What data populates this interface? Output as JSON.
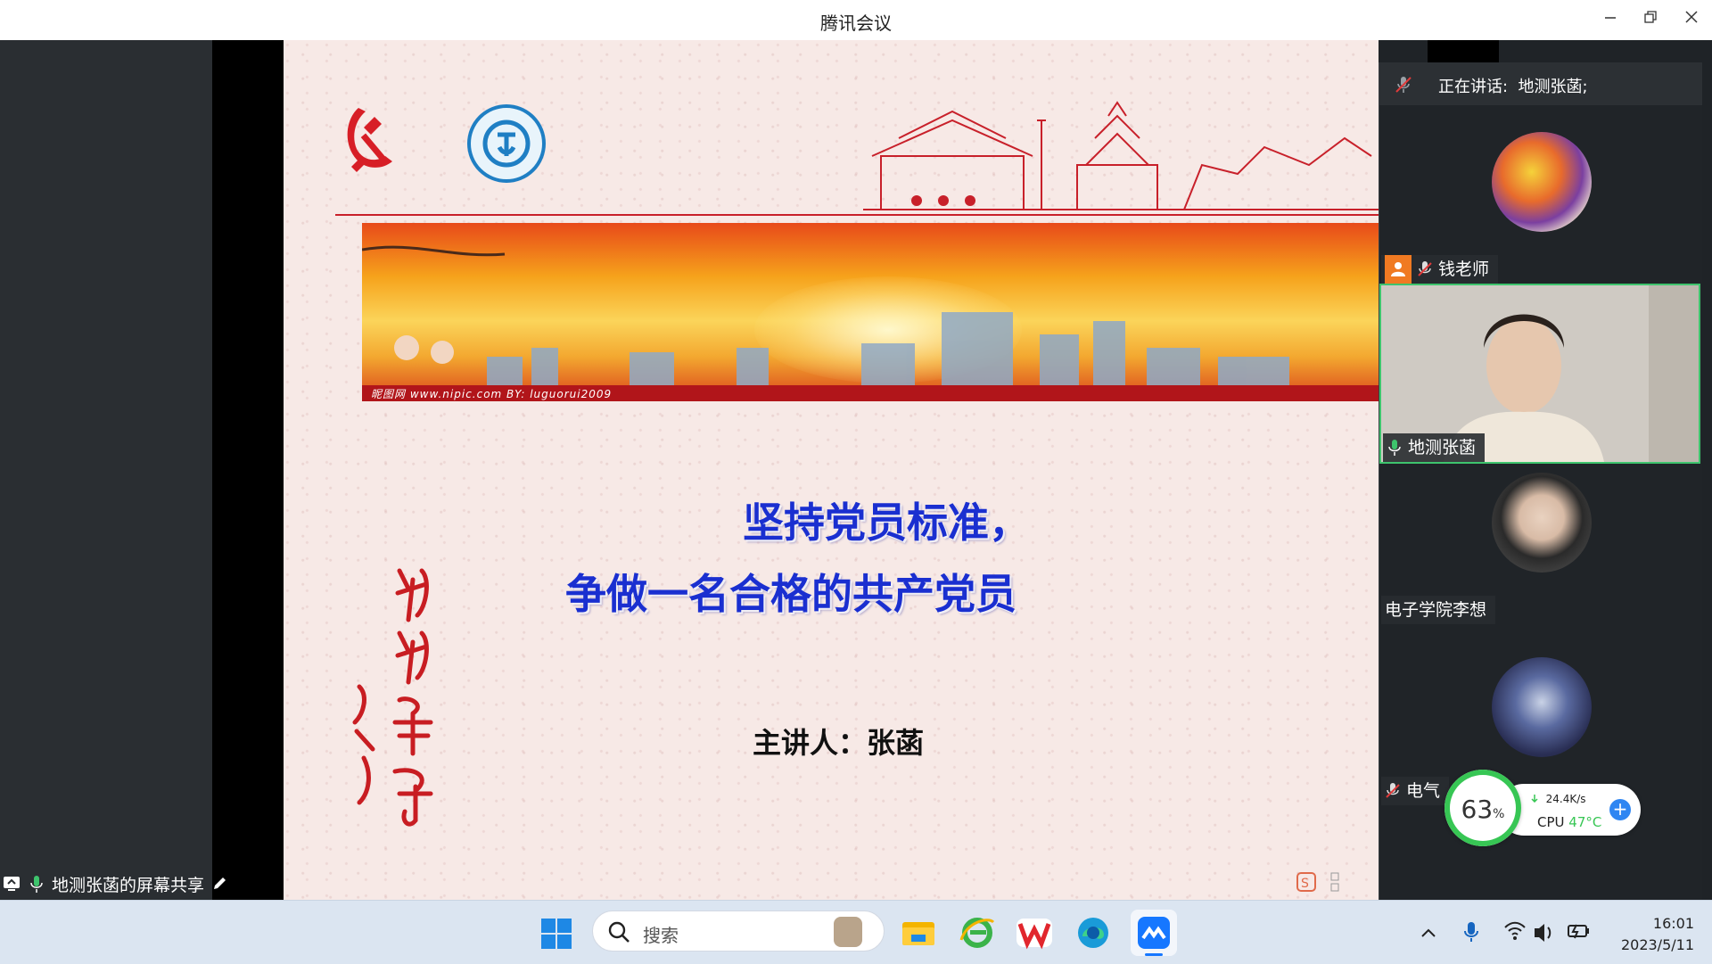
{
  "window": {
    "title": "腾讯会议"
  },
  "slide": {
    "headline_line1": "坚持党员标准，",
    "headline_line2": "争做一名合格的共产党员",
    "speaker": "主讲人：张菡",
    "banner_footer": "昵图网 www.nipic.com    BY: luguorui2009"
  },
  "panel": {
    "speaking_label": "正在讲话:",
    "speaking_name": "地测张菡;",
    "participants": [
      {
        "name": "钱老师",
        "role": "host"
      },
      {
        "name": "地测张菡"
      },
      {
        "name": "电子学院李想"
      },
      {
        "name": "电气"
      }
    ]
  },
  "monitor": {
    "percent": "63",
    "percent_unit": "%",
    "net_speed": "24.4K/s",
    "cpu_label": "CPU",
    "cpu_temp": "47°C"
  },
  "share": {
    "label": "地测张菡的屏幕共享"
  },
  "taskbar": {
    "search_placeholder": "搜索",
    "time": "16:01",
    "date": "2023/5/11"
  },
  "colors": {
    "headline": "#1a2fd0",
    "active_border": "#3ec46d",
    "party_red": "#c8202a"
  }
}
